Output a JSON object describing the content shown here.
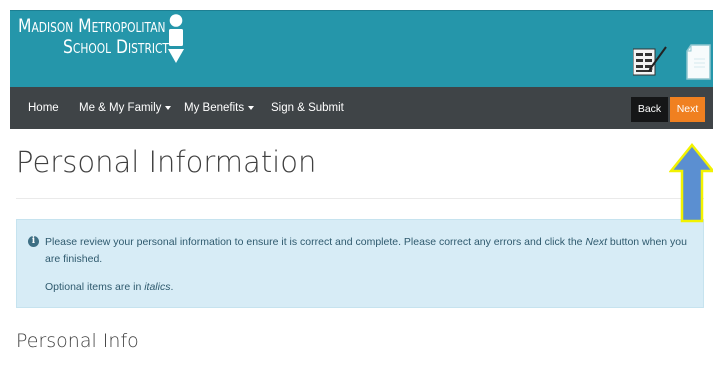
{
  "header": {
    "logo_line1": "Madison Metropolitan",
    "logo_line2": "School District",
    "brand_color": "#2596aa"
  },
  "nav": {
    "items": [
      {
        "label": "Home"
      },
      {
        "label": "Me & My Family"
      },
      {
        "label": "My Benefits"
      },
      {
        "label": "Sign & Submit"
      }
    ],
    "back_label": "Back",
    "next_label": "Next",
    "next_color": "#f08020",
    "navbar_color": "#3f4447"
  },
  "main": {
    "title": "Personal Information",
    "alert": {
      "text_before": "Please review your personal information to ensure it is correct and complete. Please correct any errors and click the ",
      "text_emphasis": "Next",
      "text_after": " button when you are finished.",
      "optional_prefix": "Optional items are in ",
      "optional_emphasis": "italics",
      "optional_suffix": "."
    },
    "section_title": "Personal Info"
  },
  "icons": {
    "info": "info-circle-icon",
    "nav_caret": "caret-down-icon",
    "document_sign": "document-sign-icon",
    "document_blank": "document-icon",
    "callout": "up-arrow-callout"
  }
}
